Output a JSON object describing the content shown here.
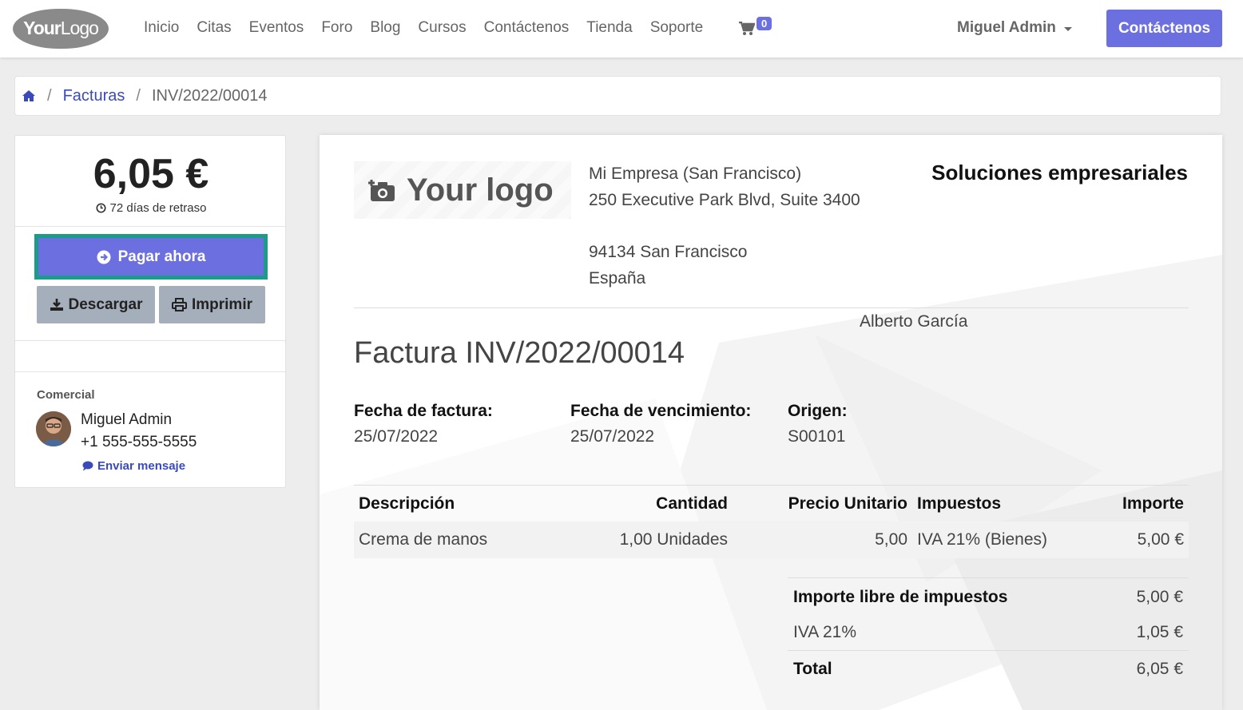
{
  "navbar": {
    "logo": {
      "your": "Your",
      "logo": "Logo"
    },
    "links": [
      "Inicio",
      "Citas",
      "Eventos",
      "Foro",
      "Blog",
      "Cursos",
      "Contáctenos",
      "Tienda",
      "Soporte"
    ],
    "cart_count": "0",
    "user_name": "Miguel Admin",
    "cta_label": "Contáctenos"
  },
  "breadcrumb": {
    "items": [
      "Facturas"
    ],
    "current": "INV/2022/00014"
  },
  "sidebar": {
    "amount": "6,05 €",
    "overdue_text": "72 días de retraso",
    "pay_label": "Pagar ahora",
    "download_label": "Descargar",
    "print_label": "Imprimir",
    "salesperson": {
      "title": "Comercial",
      "name": "Miguel Admin",
      "phone": "+1 555-555-5555",
      "message_label": "Enviar mensaje"
    }
  },
  "invoice": {
    "logo_text": "Your logo",
    "company_lines": [
      "Mi Empresa (San Francisco)",
      "250 Executive Park Blvd, Suite 3400",
      "",
      "94134 San Francisco",
      "España"
    ],
    "tagline": "Soluciones empresariales",
    "customer": "Alberto García",
    "title": "Factura INV/2022/00014",
    "info": [
      {
        "label": "Fecha de factura:",
        "value": "25/07/2022"
      },
      {
        "label": "Fecha de vencimiento:",
        "value": "25/07/2022"
      },
      {
        "label": "Origen:",
        "value": "S00101"
      }
    ],
    "columns": [
      "Descripción",
      "Cantidad",
      "Precio Unitario",
      "Impuestos",
      "Importe"
    ],
    "lines": [
      {
        "description": "Crema de manos",
        "quantity": "1,00 Unidades",
        "unit_price": "5,00",
        "taxes": "IVA 21% (Bienes)",
        "amount": "5,00 €"
      }
    ],
    "totals": [
      {
        "label": "Importe libre de impuestos",
        "value": "5,00 €"
      },
      {
        "label": "IVA 21%",
        "value": "1,05 €"
      },
      {
        "label": "Total",
        "value": "6,05 €"
      }
    ]
  },
  "colors": {
    "primary": "#6c6fe0",
    "highlight": "#1a9c88",
    "secondary": "#a5aebb",
    "link": "#3a4ab8"
  }
}
